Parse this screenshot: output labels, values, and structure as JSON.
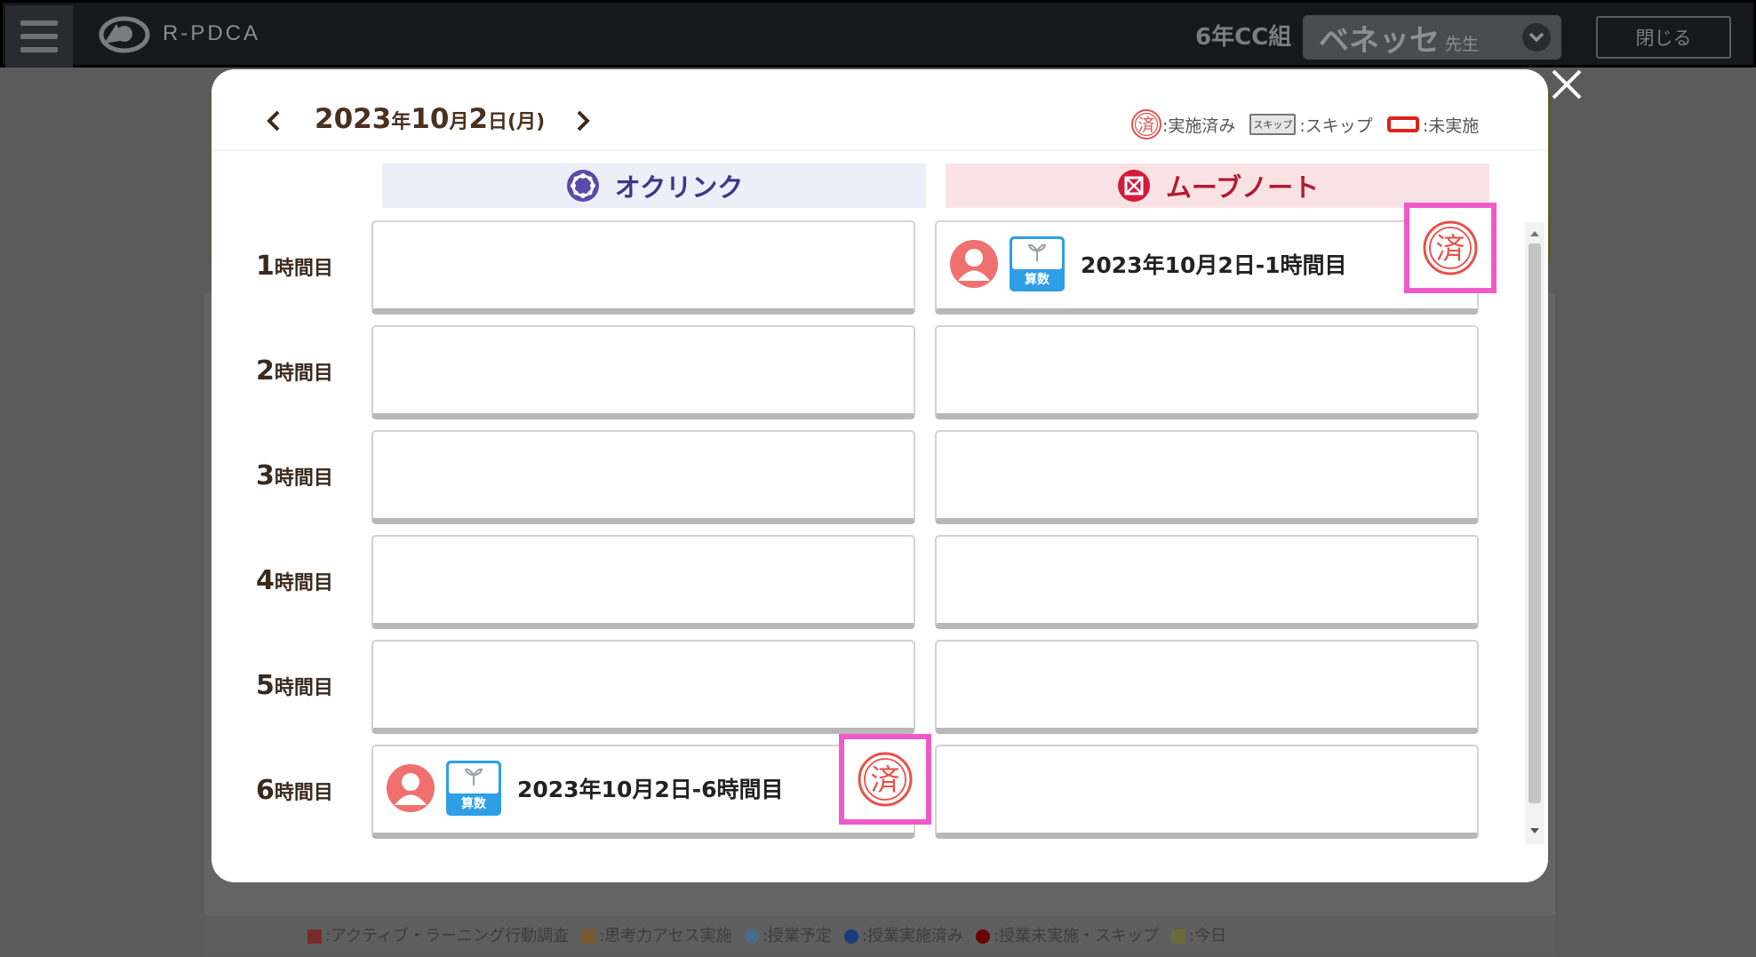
{
  "topbar": {
    "app_name": "R-PDCA",
    "class_name": "6年CC組",
    "teacher_name": "ベネッセ",
    "teacher_suffix": "先生",
    "close_label": "閉じる"
  },
  "background_legend": [
    {
      "label": ":アクティブ・ラーニング行動調査",
      "color": "#7a2a2a",
      "shape": "square"
    },
    {
      "label": ":思考力アセス実施",
      "color": "#7a5a30",
      "shape": "square"
    },
    {
      "label": ":授業予定",
      "color": "#4a6a8a",
      "shape": "circle"
    },
    {
      "label": ":授業実施済み",
      "color": "#1a3a7a",
      "shape": "circle"
    },
    {
      "label": ":授業未実施・スキップ",
      "color": "#6a0000",
      "shape": "circle"
    },
    {
      "label": ":今日",
      "color": "#6a6a3a",
      "shape": "square"
    }
  ],
  "modal": {
    "date": {
      "year": "2023",
      "year_unit": "年",
      "month": "10",
      "month_unit": "月",
      "day": "2",
      "day_unit": "日",
      "weekday": "(月)"
    },
    "legend": {
      "done_stamp": "済",
      "done_label": ":実施済み",
      "skip_badge": "スキップ",
      "skip_label": ":スキップ",
      "undone_label": ":未実施"
    },
    "columns": {
      "left": "オクリンク",
      "right": "ムーブノート"
    },
    "period_unit": "時間目",
    "periods": [
      {
        "num": "1",
        "left": null,
        "right": {
          "title": "2023年10月2日-1時間目",
          "subject": "算数",
          "stamp": "済"
        }
      },
      {
        "num": "2",
        "left": null,
        "right": null
      },
      {
        "num": "3",
        "left": null,
        "right": null
      },
      {
        "num": "4",
        "left": null,
        "right": null
      },
      {
        "num": "5",
        "left": null,
        "right": null
      },
      {
        "num": "6",
        "left": {
          "title": "2023年10月2日-6時間目",
          "subject": "算数",
          "stamp": "済"
        },
        "right": null
      }
    ]
  },
  "colors": {
    "okl_accent": "#40348a",
    "move_accent": "#b21a32",
    "highlight": "#f05ac8",
    "stamp_red": "#e8504a"
  }
}
